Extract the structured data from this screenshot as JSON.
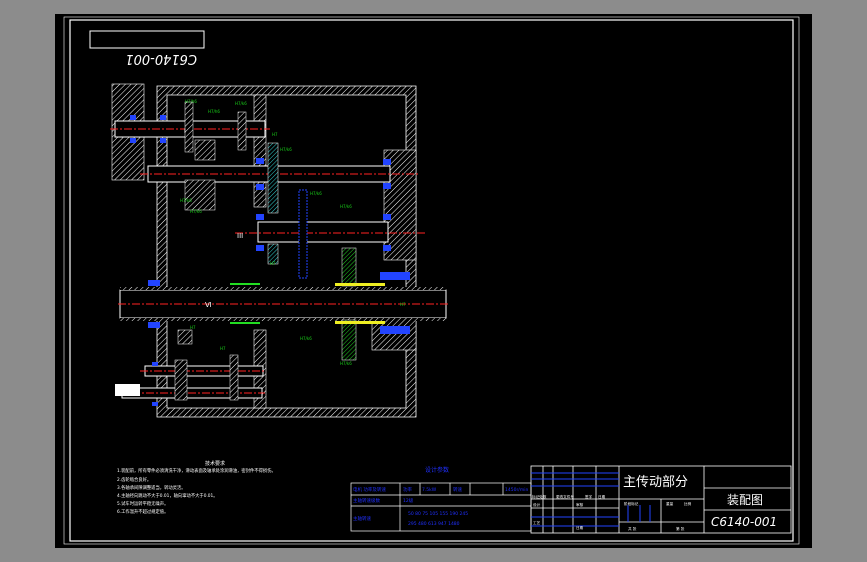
{
  "drawing": {
    "mirrored_code": "C6140-001",
    "shaft_labels": [
      "I",
      "III",
      "Ⅵ"
    ],
    "notes_title": "技术要求",
    "notes": [
      "1.装配前，所有零件必须清洗干净，滑动表面及轴承处涂润滑油，密封件不得损伤。",
      "2.齿轮啮合良好。",
      "3.各轴承间隙调整适当，转动灵活。",
      "4.主轴径向跳动不大于0.01，轴向窜动不大于0.01。",
      "5.试车时运转平稳无噪声。",
      "6.工作温升不超过规定值。"
    ],
    "param_title": "设计参数",
    "param_table": {
      "row1": [
        "电机 功率及转速",
        "功率",
        "7.5kW",
        "转速",
        "1450r/min"
      ],
      "row2": [
        "主轴转速级数",
        "12级"
      ],
      "row3_label": "主轴转速",
      "speeds1": "50 80 75 105 155 190 245",
      "speeds2": "295 480 613 947 1480"
    },
    "title_block": {
      "name": "主传动部分",
      "drawing_type": "装配图",
      "code": "C6140-001",
      "labels": [
        "标记处数",
        "更改文件号",
        "签字",
        "日期",
        "设计",
        "审核",
        "工艺",
        "日期",
        "阶段标记",
        "重量",
        "比例",
        "共 张",
        "第 张"
      ]
    }
  }
}
